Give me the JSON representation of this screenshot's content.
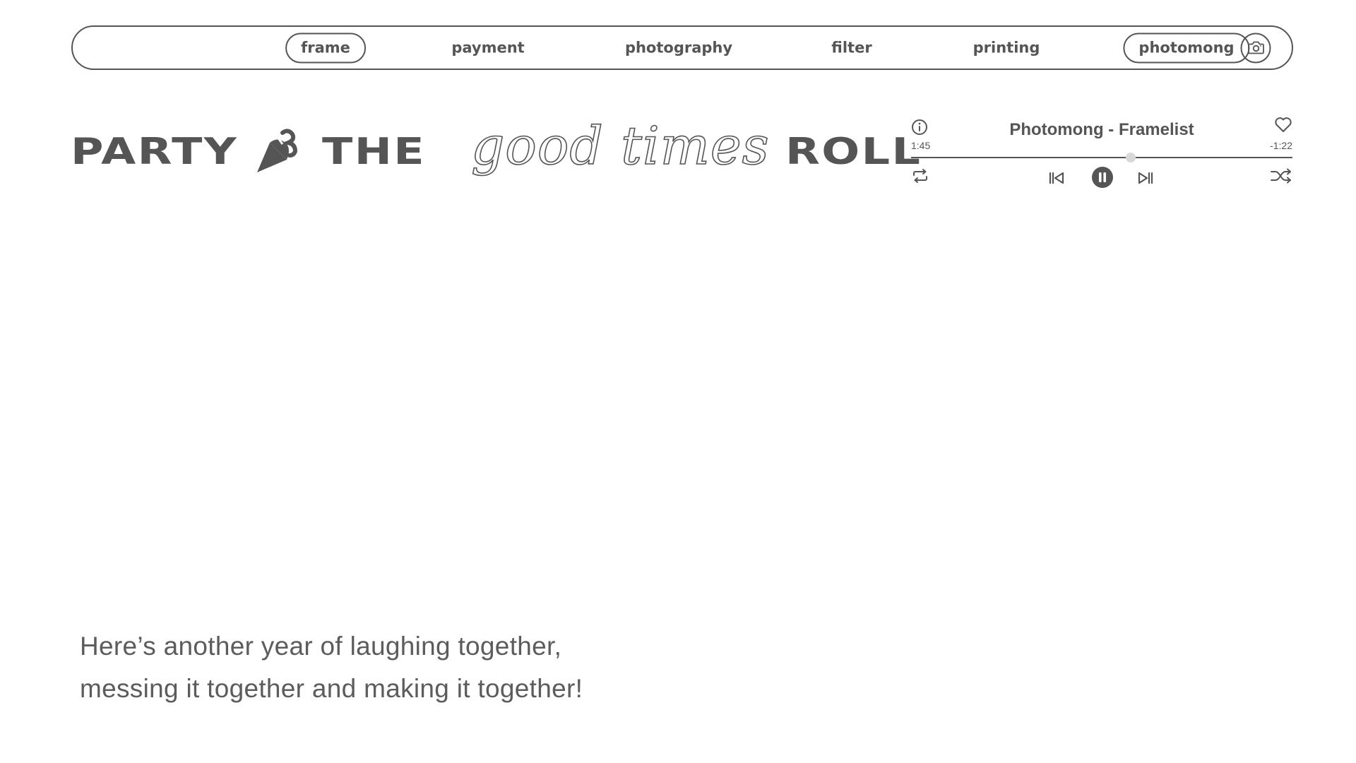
{
  "nav": {
    "items": [
      {
        "label": "frame",
        "active": true
      },
      {
        "label": "payment",
        "active": false
      },
      {
        "label": "photography",
        "active": false
      },
      {
        "label": "filter",
        "active": false
      },
      {
        "label": "printing",
        "active": false
      }
    ],
    "brand_label": "photomong",
    "camera_icon": "camera-icon"
  },
  "headline": {
    "word1": "PARTY",
    "ampersand_icon": "party-popper-icon",
    "word2": "THE",
    "script": "good times",
    "word3": "ROLL"
  },
  "player": {
    "track_title": "Photomong - Framelist",
    "elapsed": "1:45",
    "remaining": "-1:22",
    "progress_fraction": 0.575,
    "icons": {
      "info": "info-icon",
      "like": "heart-icon",
      "repeat": "repeat-icon",
      "previous": "skip-previous-icon",
      "pause": "pause-icon",
      "next": "skip-next-icon",
      "shuffle": "shuffle-icon"
    }
  },
  "message": {
    "line1": "Here’s another year of laughing together,",
    "line2": "messing it together and making it together!"
  },
  "colors": {
    "text": "#555555",
    "background": "#ffffff",
    "knob": "#d8d8d8"
  }
}
